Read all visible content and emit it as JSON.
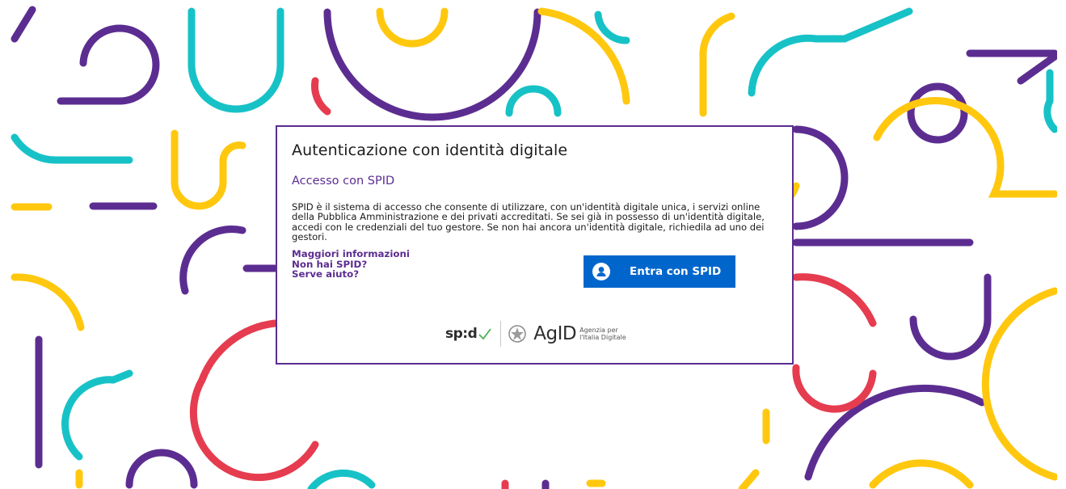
{
  "dialog": {
    "title": "Autenticazione con identità digitale",
    "subtitle": "Accesso con SPID",
    "description": "SPID è il sistema di accesso che consente di utilizzare, con un'identità digitale unica, i servizi online della Pubblica Amministrazione e dei privati accreditati. Se sei già in possesso di un'identità digitale, accedi con le credenziali del tuo gestore. Se non hai ancora un'identità digitale, richiedila ad uno dei gestori.",
    "links": [
      {
        "label": "Maggiori informazioni"
      },
      {
        "label": "Non hai SPID?"
      },
      {
        "label": "Serve aiuto?"
      }
    ],
    "button": {
      "label": "Entra con SPID",
      "icon": "user-icon"
    }
  },
  "footer_logos": {
    "spid_logo": "sp:d",
    "agid_logo": "AgID",
    "agid_sub_line1": "Agenzia per",
    "agid_sub_line2": "l'Italia Digitale"
  },
  "colors": {
    "accent_purple": "#5c2d91",
    "button_blue": "#0066cc",
    "bg_purple": "#5c2d91",
    "bg_teal": "#17c2c7",
    "bg_yellow": "#ffc80f",
    "bg_red": "#e63c50",
    "spid_check_green": "#4caf50"
  }
}
